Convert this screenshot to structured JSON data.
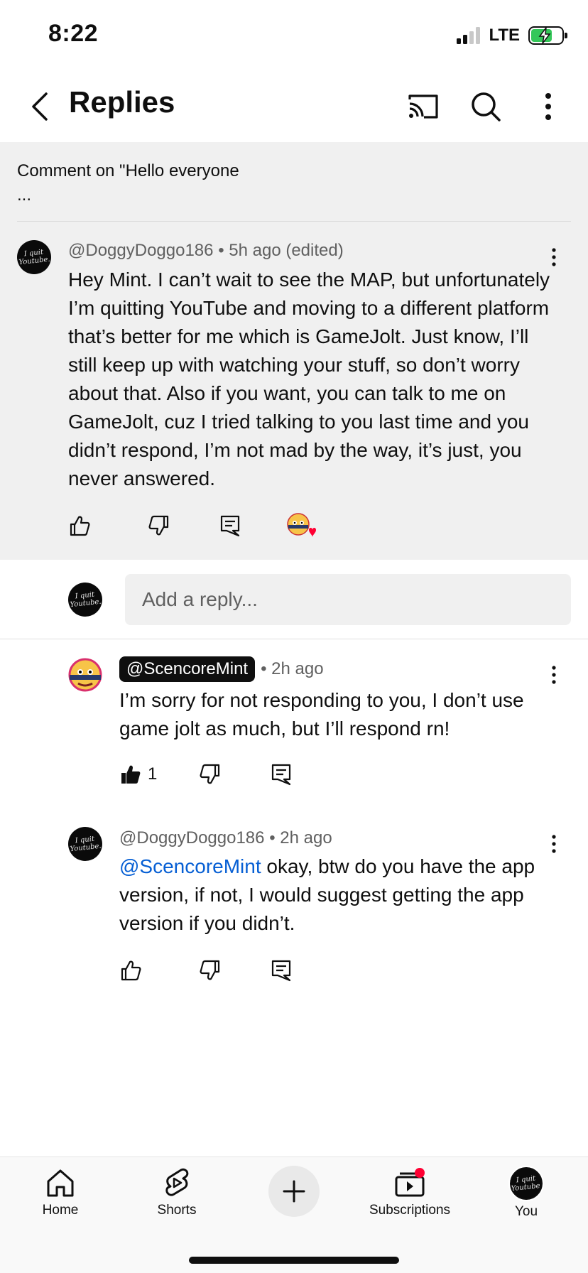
{
  "status": {
    "time": "8:22",
    "network": "LTE"
  },
  "header": {
    "title": "Replies"
  },
  "top_comment": {
    "context": "Comment on \"Hello everyone",
    "context_more": "...",
    "author": "@DoggyDoggo186",
    "meta": "• 5h ago (edited)",
    "avatar_text": "I quit Youtube.",
    "text": "Hey Mint. I can’t wait to see the MAP, but unfortunately I’m quitting YouTube and moving to a different platform that’s better for me which is GameJolt. Just know, I’ll still keep up with watching your stuff, so don’t worry about that. Also if you want, you can talk to me on GameJolt, cuz I tried talking to you last time and you didn’t respond, I’m not mad by the way, it’s just, you never answered."
  },
  "reply_input": {
    "placeholder": "Add a reply..."
  },
  "replies": [
    {
      "author": "@ScencoreMint",
      "meta": "• 2h ago",
      "text": "I’m sorry for not responding to you, I don’t use game jolt as much, but I’ll respond rn!",
      "likes": "1"
    },
    {
      "author": "@DoggyDoggo186",
      "meta": "• 2h ago",
      "mention": "@ScencoreMint",
      "text": " okay, btw do you have the app version, if not, I would suggest getting the app version if you didn’t.",
      "avatar_text": "I quit Youtube."
    }
  ],
  "nav": {
    "home": "Home",
    "shorts": "Shorts",
    "subscriptions": "Subscriptions",
    "you": "You"
  },
  "colors": {
    "accent_link": "#065fd4",
    "heart": "#ff0033",
    "battery": "#34c759",
    "notification_dot": "#ff0033"
  }
}
